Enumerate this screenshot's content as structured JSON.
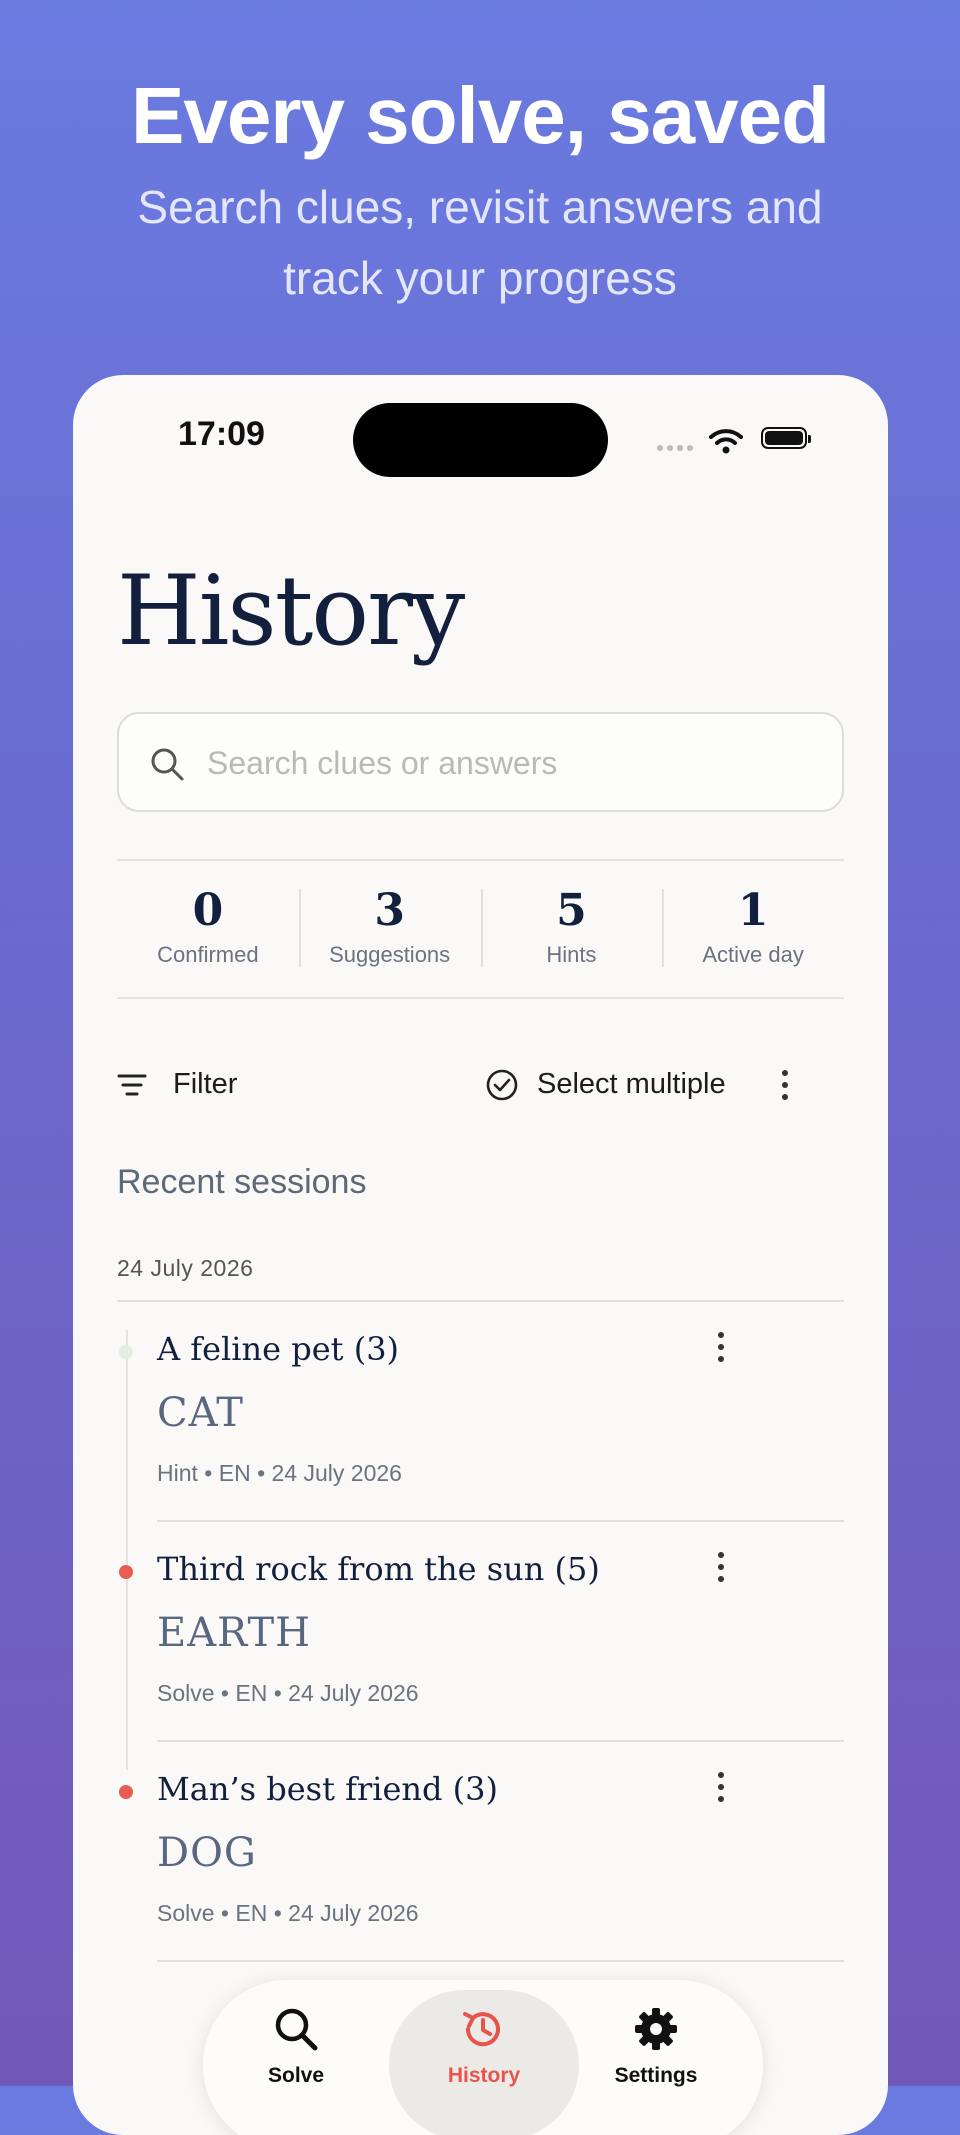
{
  "promo": {
    "headline": "Every solve, saved",
    "subhead": "Search clues, revisit answers and track your progress"
  },
  "status_bar": {
    "time": "17:09"
  },
  "page": {
    "title": "History"
  },
  "search": {
    "placeholder": "Search clues or answers"
  },
  "stats": [
    {
      "value": "0",
      "label": "Confirmed"
    },
    {
      "value": "3",
      "label": "Suggestions"
    },
    {
      "value": "5",
      "label": "Hints"
    },
    {
      "value": "1",
      "label": "Active day"
    }
  ],
  "toolbar": {
    "filter_label": "Filter",
    "select_label": "Select multiple"
  },
  "recent": {
    "section_title": "Recent sessions",
    "date_header": "24 July 2026",
    "entries": [
      {
        "clue": "A feline pet (3)",
        "answer": "CAT",
        "meta": "Hint  •  EN  •  24 July 2026",
        "dot_color": "#e4efe2"
      },
      {
        "clue": "Third rock from the sun (5)",
        "answer": "EARTH",
        "meta": "Solve  •  EN  •  24 July 2026",
        "dot_color": "#ea5b52"
      },
      {
        "clue": "Man’s best friend (3)",
        "answer": "DOG",
        "meta": "Solve  •  EN  •  24 July 2026",
        "dot_color": "#ea5b52"
      }
    ]
  },
  "tabs": [
    {
      "label": "Solve",
      "icon": "search-icon",
      "active": false
    },
    {
      "label": "History",
      "icon": "history-icon",
      "active": true
    },
    {
      "label": "Settings",
      "icon": "gear-icon",
      "active": false
    }
  ],
  "colors": {
    "accent": "#e8534a",
    "title": "#13203d",
    "background_top": "#6a7be0",
    "background_bottom": "#7258b8"
  }
}
